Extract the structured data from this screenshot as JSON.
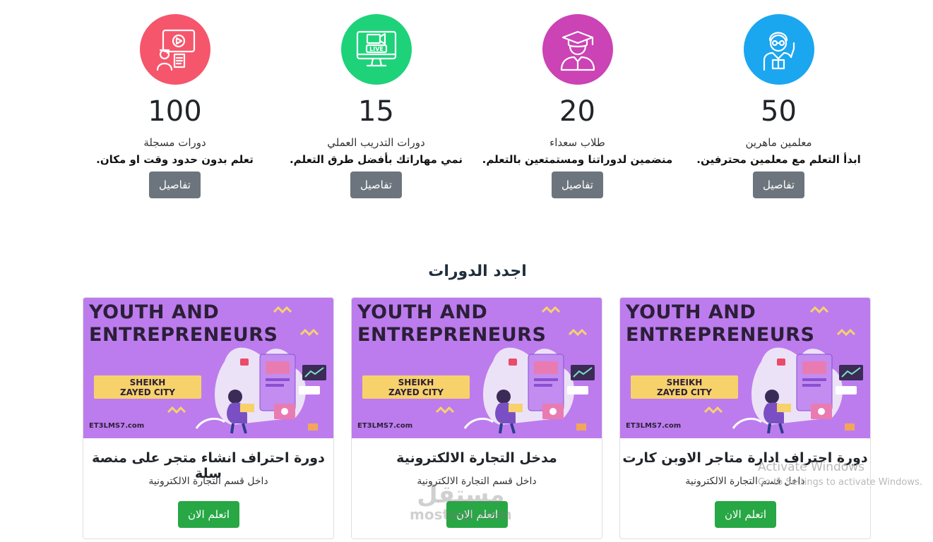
{
  "stats": [
    {
      "number": "100",
      "label": "دورات مسجلة",
      "desc": "تعلم بدون حدود وقت او مكان.",
      "button": "تفاصيل",
      "color": "#f5566c",
      "icon": "video-course-icon"
    },
    {
      "number": "15",
      "label": "دورات التدريب العملي",
      "desc": "نمي مهاراتك بأفضل طرق التعلم.",
      "button": "تفاصيل",
      "color": "#1ed27a",
      "icon": "live-training-icon"
    },
    {
      "number": "20",
      "label": "طلاب سعداء",
      "desc": "منضمين لدوراتنا ومستمتعين بالتعلم.",
      "button": "تفاصيل",
      "color": "#cb43b4",
      "icon": "graduate-student-icon"
    },
    {
      "number": "50",
      "label": "معلمين ماهرين",
      "desc": "ابدأ التعلم مع معلمين محترفين.",
      "button": "تفاصيل",
      "color": "#1ba6f0",
      "icon": "teacher-icon"
    }
  ],
  "section_title": "اجدد الدورات",
  "courses": [
    {
      "title": "دورة احتراف انشاء متجر على منصة سلة",
      "category": "داخل قسم التجارة الالكترونية",
      "button": "اتعلم الان"
    },
    {
      "title": "مدخل التجارة الالكترونية",
      "category": "داخل قسم التجارة الالكترونية",
      "button": "اتعلم الان"
    },
    {
      "title": "دورة احتراف ادارة متاجر الاوبن كارت",
      "category": "داخل قسم التجارة الالكترونية",
      "button": "اتعلم الان"
    }
  ],
  "banner": {
    "line1": "YOUTH AND",
    "line2": "ENTREPRENEURS",
    "city_line1": "SHEIKH",
    "city_line2": "ZAYED CITY",
    "site": "ET3LMS7.com",
    "color": "#bd7ced"
  },
  "os_watermark": {
    "line1": "Activate Windows",
    "line2": "Go to Settings to activate Windows."
  },
  "site_watermark": {
    "line1": "مستقل",
    "line2": "mostaql.com"
  }
}
